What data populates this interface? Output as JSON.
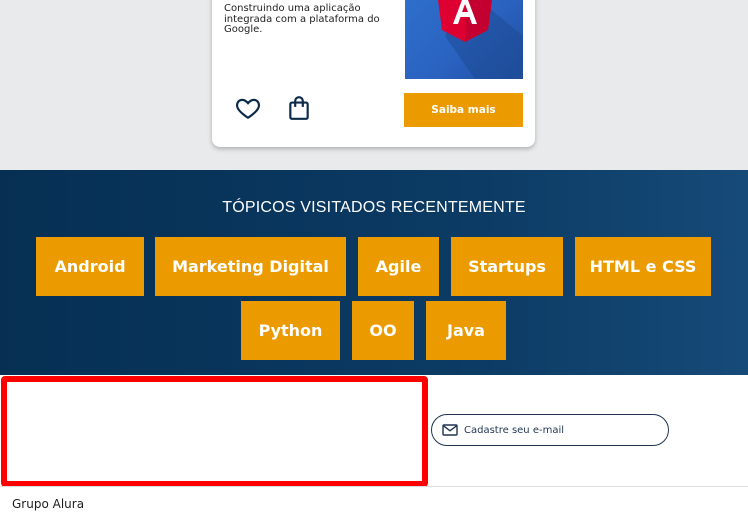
{
  "course_card": {
    "description": "Construindo uma aplicação integrada com a plataforma do Google.",
    "thumbnail_icon": "angular-logo-icon",
    "favorite_icon": "heart-icon",
    "cart_icon": "shopping-bag-icon",
    "cta_label": "Saiba mais"
  },
  "topics": {
    "title": "TÓPICOS VISITADOS RECENTEMENTE",
    "items": [
      "Android",
      "Marketing Digital",
      "Agile",
      "Startups",
      "HTML e CSS",
      "Python",
      "OO",
      "Java"
    ]
  },
  "newsletter": {
    "email_icon": "mail-icon",
    "email_label": "Cadastre seu e-mail"
  },
  "footer": {
    "company": "Grupo Alura"
  },
  "colors": {
    "accent": "#eb9b00",
    "navy": "#062f53",
    "highlight_border": "#ff0000"
  }
}
